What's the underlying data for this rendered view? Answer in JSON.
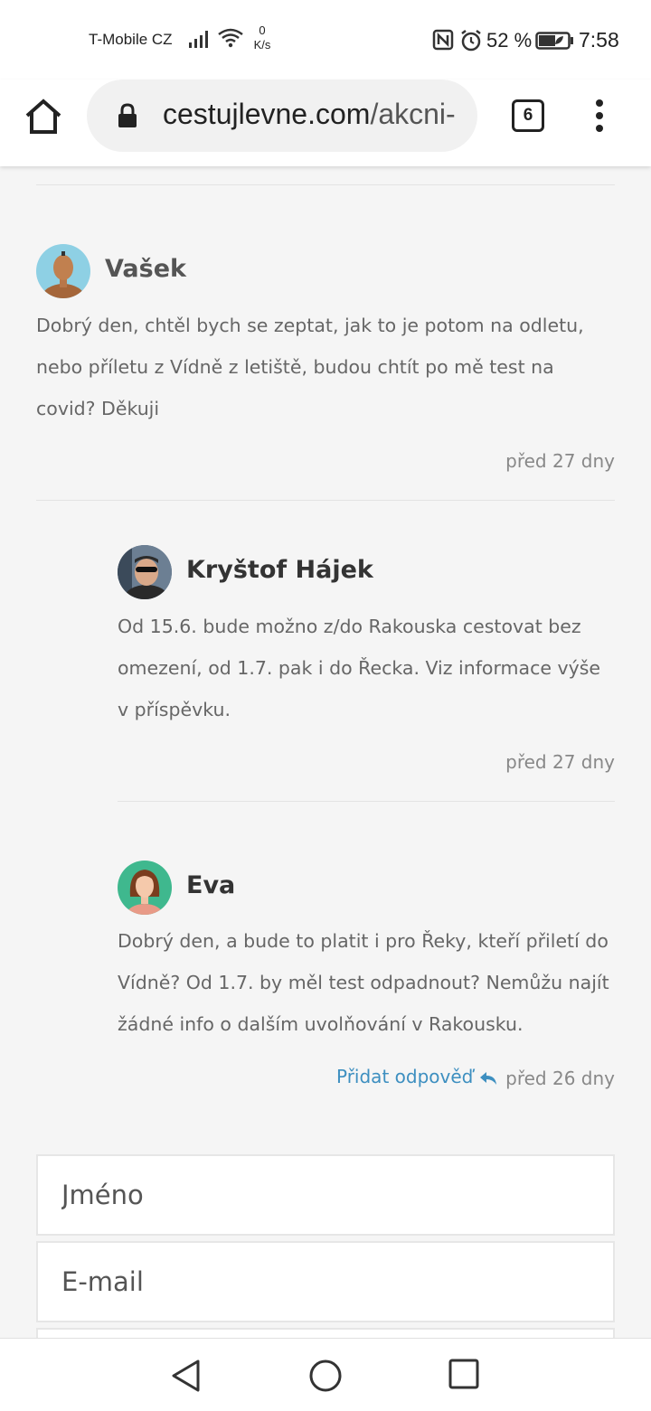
{
  "status_bar": {
    "carrier": "T-Mobile CZ",
    "net_speed_value": "0",
    "net_speed_unit": "K/s",
    "battery": "52 %",
    "time": "7:58",
    "icons": [
      "signal-icon",
      "wifi-icon",
      "nfc-icon",
      "alarm-icon",
      "battery-saver-icon"
    ]
  },
  "browser": {
    "url_domain": "cestujlevne.com",
    "url_path": "/akcni-",
    "tab_count": "6",
    "icons": [
      "home-icon",
      "lock-icon",
      "more-icon"
    ]
  },
  "comments": [
    {
      "author": "Vašek",
      "text": "Dobrý den, chtěl bych se zeptat, jak to je potom na odletu, nebo příletu z Vídně z letiště, budou chtít po mě test na covid? Děkuji",
      "time": "před 27 dny"
    },
    {
      "author": "Kryštof Hájek",
      "text": "Od 15.6. bude možno z/do Rakouska cestovat bez omezení, od 1.7. pak i do Řecka. Viz informace výše v příspěvku.",
      "time": "před 27 dny"
    },
    {
      "author": "Eva",
      "text": "Dobrý den, a bude to platit i pro Řeky, kteří přiletí do Vídně? Od 1.7. by měl test odpadnout? Nemůžu najít žádné info o dalším uvolňování v Rakousku.",
      "time": "před 26 dny",
      "reply_label": "Přidat odpověď"
    }
  ],
  "form": {
    "name_placeholder": "Jméno",
    "email_placeholder": "E-mail"
  },
  "nav_bar": {
    "icons": [
      "back-icon",
      "home-circle-icon",
      "recent-apps-icon"
    ]
  },
  "colors": {
    "link": "#3d8fc0",
    "page_bg": "#f5f5f5"
  }
}
